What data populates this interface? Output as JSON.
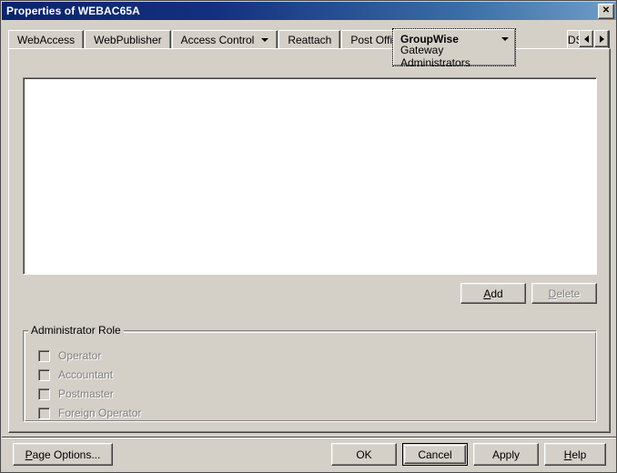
{
  "window": {
    "title": "Properties of WEBAC65A",
    "close_button_label": "✕",
    "close_icon_name": "close-icon",
    "titlebar_color": "#0a246a",
    "face_color": "#d4d0c8"
  },
  "tabs": {
    "items": [
      {
        "label": "WebAccess",
        "has_dropdown": false,
        "clipped": false
      },
      {
        "label": "WebPublisher",
        "has_dropdown": false,
        "clipped": false
      },
      {
        "label": "Access Control",
        "has_dropdown": true,
        "clipped": false
      },
      {
        "label": "Reattach",
        "has_dropdown": false,
        "clipped": false
      },
      {
        "label": "Post Office Links",
        "has_dropdown": false,
        "clipped": false
      },
      {
        "label": "NDS Rights",
        "has_dropdown": false,
        "clipped": true
      }
    ],
    "active": {
      "label": "GroupWise",
      "submenu_label": "Gateway Administrators",
      "has_dropdown": true
    },
    "scroll_left_label": "◄",
    "scroll_right_label": "►"
  },
  "list": {
    "rows": [],
    "empty": true
  },
  "list_actions": {
    "add_label": "Add",
    "add_accel": "A",
    "add_enabled": true,
    "delete_label": "Delete",
    "delete_accel": "D",
    "delete_enabled": false
  },
  "administrator_role": {
    "legend": "Administrator Role",
    "checkboxes": [
      {
        "label": "Operator",
        "checked": false,
        "enabled": false
      },
      {
        "label": "Accountant",
        "checked": false,
        "enabled": false
      },
      {
        "label": "Postmaster",
        "checked": false,
        "enabled": false
      },
      {
        "label": "Foreign Operator",
        "checked": false,
        "enabled": false
      }
    ]
  },
  "footer": {
    "page_options_label": "Page Options...",
    "page_options_accel": "P",
    "ok_label": "OK",
    "cancel_label": "Cancel",
    "apply_label": "Apply",
    "help_label": "Help",
    "help_accel": "H",
    "default_button": "Cancel"
  }
}
